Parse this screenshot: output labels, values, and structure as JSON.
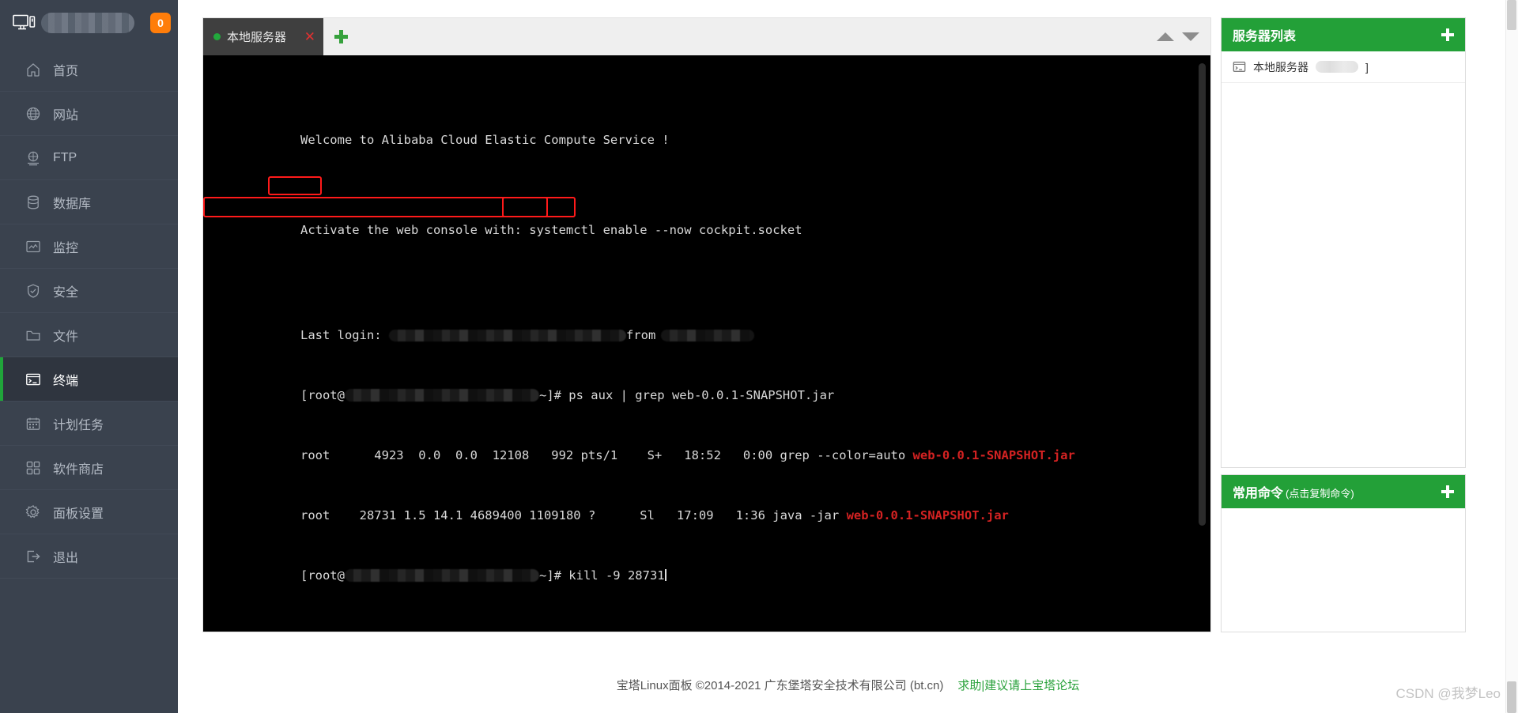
{
  "header": {
    "hostname_redacted": true,
    "notification_count": "0",
    "accent_orange": "#ff7d0a"
  },
  "sidebar": {
    "background": "#3a424e",
    "active_accent": "#20a53a",
    "items": [
      {
        "label": "首页",
        "icon": "home-icon",
        "active": false
      },
      {
        "label": "网站",
        "icon": "globe-icon",
        "active": false
      },
      {
        "label": "FTP",
        "icon": "ftp-icon",
        "active": false
      },
      {
        "label": "数据库",
        "icon": "database-icon",
        "active": false
      },
      {
        "label": "监控",
        "icon": "monitor-icon",
        "active": false
      },
      {
        "label": "安全",
        "icon": "shield-icon",
        "active": false
      },
      {
        "label": "文件",
        "icon": "folder-icon",
        "active": false
      },
      {
        "label": "终端",
        "icon": "terminal-icon",
        "active": true
      },
      {
        "label": "计划任务",
        "icon": "calendar-icon",
        "active": false
      },
      {
        "label": "软件商店",
        "icon": "grid-icon",
        "active": false
      },
      {
        "label": "面板设置",
        "icon": "gear-icon",
        "active": false
      },
      {
        "label": "退出",
        "icon": "logout-icon",
        "active": false
      }
    ]
  },
  "terminal": {
    "tab": {
      "title": "本地服务器",
      "status_dot_color": "#22a93c",
      "close_label": "✕"
    },
    "add_tab_label": "+",
    "scroll_up_label": "▲",
    "scroll_down_label": "▼",
    "console": {
      "background": "#000000",
      "foreground": "#d9d9d9",
      "highlight_color": "#d42222",
      "annotation_box_color": "#ff1a1a",
      "lines": [
        {
          "id": "welcome",
          "text": "Welcome to Alibaba Cloud Elastic Compute Service !"
        },
        {
          "id": "blank1",
          "text": ""
        },
        {
          "id": "activate",
          "text": "Activate the web console with: systemctl enable --now cockpit.socket"
        },
        {
          "id": "blank2",
          "text": ""
        },
        {
          "id": "lastlogin_prefix",
          "text": "Last login: "
        },
        {
          "id": "lastlogin_from",
          "text": "from"
        },
        {
          "id": "prompt1_pre",
          "text": "[root@"
        },
        {
          "id": "prompt1_post",
          "text": "~]# ps aux | grep web-0.0.1-SNAPSHOT.jar"
        },
        {
          "id": "ps_row1_plain",
          "text": "root      4923  0.0  0.0  12108   992 pts/1    S+   18:52   0:00 grep --color=auto "
        },
        {
          "id": "ps_row1_red",
          "text": "web-0.0.1-SNAPSHOT.jar"
        },
        {
          "id": "ps_row2_user",
          "text": "root    "
        },
        {
          "id": "ps_row2_pid",
          "text": "28731"
        },
        {
          "id": "ps_row2_rest",
          "text": " 1.5 14.1 4689400 1109180 ?      Sl   17:09   1:36 java -jar "
        },
        {
          "id": "ps_row2_red",
          "text": "web-0.0.1-SNAPSHOT.jar"
        },
        {
          "id": "prompt2_pre",
          "text": "[root@"
        },
        {
          "id": "prompt2_cmd",
          "text": "~]# kill -9 "
        },
        {
          "id": "prompt2_pid",
          "text": "28731"
        }
      ],
      "annotations": [
        {
          "name": "pid-column-box",
          "target": "28731 in ps output"
        },
        {
          "name": "kill-command-box",
          "target": "kill -9 28731 prompt line"
        },
        {
          "name": "kill-pid-box",
          "target": "28731 argument"
        }
      ]
    }
  },
  "server_panel": {
    "title": "服务器列表",
    "add_label": "+",
    "rows": [
      {
        "name": "本地服务器",
        "icon": "terminal-icon",
        "suffix": "]"
      }
    ]
  },
  "command_panel": {
    "title": "常用命令",
    "subtitle": "(点击复制命令)",
    "add_label": "+",
    "rows": []
  },
  "footer": {
    "copyright": "宝塔Linux面板 ©2014-2021 广东堡塔安全技术有限公司 (bt.cn)",
    "link": "求助|建议请上宝塔论坛",
    "link_color": "#2aa23c"
  },
  "watermark": {
    "text": "CSDN @我梦Leo"
  }
}
